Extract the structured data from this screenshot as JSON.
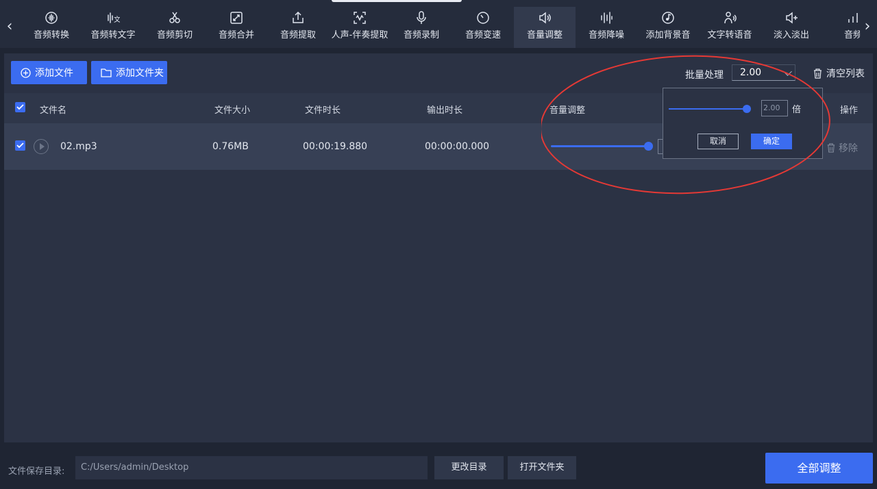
{
  "toolbar": {
    "items": [
      {
        "label": "音频转换",
        "icon": "audio-convert-icon"
      },
      {
        "label": "音频转文字",
        "icon": "speech-to-text-icon"
      },
      {
        "label": "音频剪切",
        "icon": "scissors-icon"
      },
      {
        "label": "音频合并",
        "icon": "merge-icon"
      },
      {
        "label": "音频提取",
        "icon": "extract-icon"
      },
      {
        "label": "人声-伴奏提取",
        "icon": "waveform-icon"
      },
      {
        "label": "音频录制",
        "icon": "microphone-icon"
      },
      {
        "label": "音频变速",
        "icon": "speed-icon"
      },
      {
        "label": "音量调整",
        "icon": "volume-icon"
      },
      {
        "label": "音频降噪",
        "icon": "denoise-icon"
      },
      {
        "label": "添加背景音",
        "icon": "music-note-icon"
      },
      {
        "label": "文字转语音",
        "icon": "text-to-speech-icon"
      },
      {
        "label": "淡入淡出",
        "icon": "fade-icon"
      },
      {
        "label": "音频",
        "icon": "bars-icon"
      }
    ],
    "active_index": 8
  },
  "actions": {
    "add_file": "添加文件",
    "add_folder": "添加文件夹",
    "batch_label": "批量处理",
    "batch_value": "2.00",
    "clear_list": "清空列表"
  },
  "table": {
    "headers": {
      "filename": "文件名",
      "size": "文件大小",
      "duration": "文件时长",
      "output_duration": "输出时长",
      "volume": "音量调整",
      "action": "操作"
    },
    "rows": [
      {
        "filename": "02.mp3",
        "size": "0.76MB",
        "duration": "00:00:19.880",
        "output_duration": "00:00:00.000",
        "remove": "移除"
      }
    ]
  },
  "popup": {
    "value": "2.00",
    "unit": "倍",
    "cancel": "取消",
    "confirm": "确定"
  },
  "footer": {
    "save_dir_label": "文件保存目录:",
    "save_dir_path": "C:/Users/admin/Desktop",
    "change_dir": "更改目录",
    "open_folder": "打开文件夹",
    "run_all": "全部调整"
  },
  "colors": {
    "accent": "#3b6cf0",
    "annotation": "#e53935"
  }
}
